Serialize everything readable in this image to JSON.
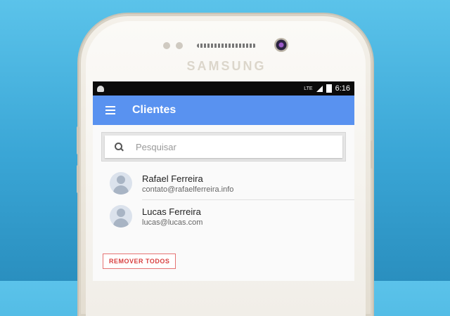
{
  "status_bar": {
    "network": "LTE",
    "time": "6:16"
  },
  "device": {
    "brand": "SAMSUNG"
  },
  "app_bar": {
    "title": "Clientes"
  },
  "search": {
    "placeholder": "Pesquisar",
    "value": ""
  },
  "clients": [
    {
      "name": "Rafael Ferreira",
      "email": "contato@rafaelferreira.info"
    },
    {
      "name": "Lucas Ferreira",
      "email": "lucas@lucas.com"
    }
  ],
  "actions": {
    "remove_all_label": "REMOVER TODOS"
  },
  "colors": {
    "app_bar": "#5992f0",
    "remove_accent": "#d84040",
    "background": "#3aa6d6"
  }
}
